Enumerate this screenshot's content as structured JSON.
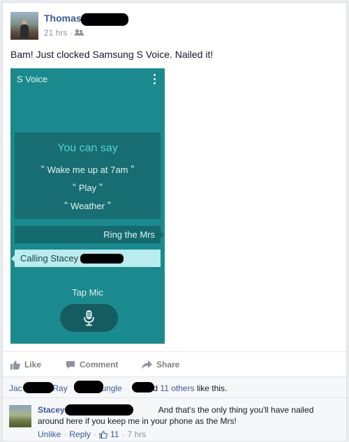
{
  "post": {
    "author_name": "Thomas",
    "time": "21 hrs ·",
    "privacy_icon": "friends-icon",
    "text": "Bam! Just clocked Samsung S Voice. Nailed it!"
  },
  "phone": {
    "app_title": "S Voice",
    "suggestions_title": "You can say",
    "open_quote": "“",
    "close_quote": "”",
    "suggestions": [
      "Wake me up at 7am",
      "Play",
      "Weather"
    ],
    "user_bubble": "Ring the Mrs",
    "reply_bubble": "Calling Stacey",
    "tap_mic": "Tap Mic",
    "colors": {
      "background": "#1b8a8e",
      "panel": "#176d72",
      "accent": "#56d0d4",
      "reply": "#b9ecee"
    }
  },
  "actions": {
    "like": "Like",
    "comment": "Comment",
    "share": "Share"
  },
  "likes": {
    "name1": "Jac",
    "name2": "Ray",
    "name3": ", Jungle",
    "conj": "and",
    "others": "11 others",
    "suffix": "like this."
  },
  "comment": {
    "author_name": "Stacey",
    "text": "And that's the only thing you'll have nailed around here if you keep me in your phone as the Mrs!",
    "unlike": "Unlike",
    "reply": "Reply",
    "like_count": "11",
    "time": "7 hrs",
    "sep": "·"
  }
}
